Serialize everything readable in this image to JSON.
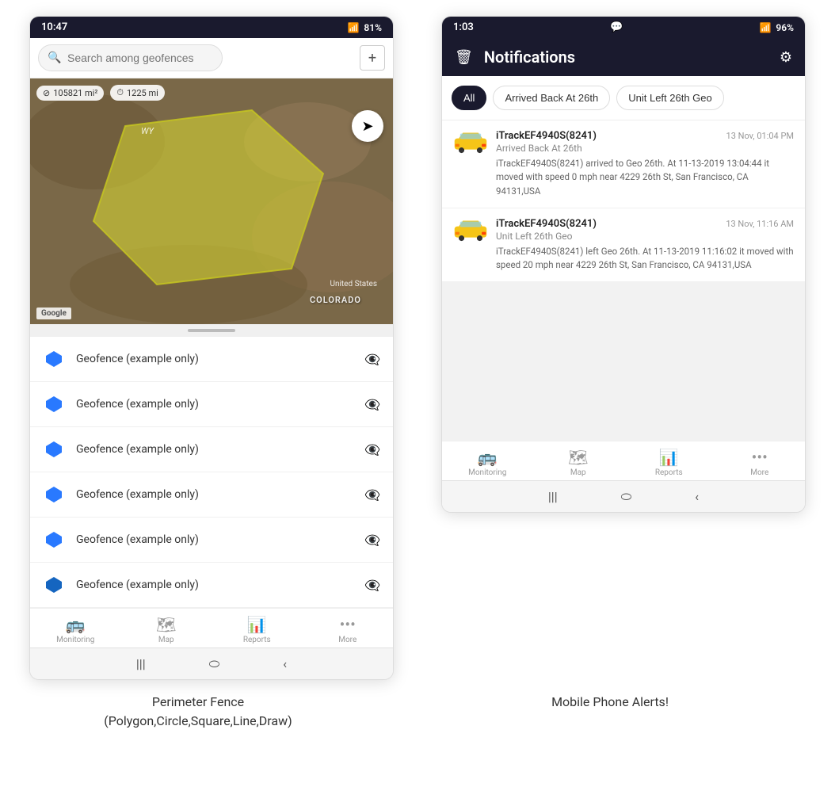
{
  "left_phone": {
    "status_bar": {
      "time": "10:47",
      "battery": "81%",
      "signal": "WiFi+LTE"
    },
    "search": {
      "placeholder": "Search among geofences"
    },
    "map": {
      "stat1_icon": "⊘",
      "stat1_value": "105821 mi²",
      "stat2_icon": "⏱",
      "stat2_value": "1225 mi",
      "wy_label": "WY",
      "colorado_label": "COLORADO",
      "us_label": "United States",
      "google_label": "Google"
    },
    "geofence_items": [
      {
        "name": "Geofence (example only)"
      },
      {
        "name": "Geofence (example only)"
      },
      {
        "name": "Geofence (example only)"
      },
      {
        "name": "Geofence (example only)"
      },
      {
        "name": "Geofence (example only)"
      },
      {
        "name": "Geofence (example only)"
      }
    ],
    "bottom_nav": [
      {
        "label": "Monitoring",
        "icon": "🚌"
      },
      {
        "label": "Map",
        "icon": "🗺"
      },
      {
        "label": "Reports",
        "icon": "📊"
      },
      {
        "label": "More",
        "icon": "···"
      }
    ]
  },
  "right_phone": {
    "status_bar": {
      "time": "1:03",
      "battery": "96%",
      "chat_icon": true
    },
    "header": {
      "title": "Notifications",
      "trash_label": "🗑",
      "settings_label": "⚙"
    },
    "filter_tabs": [
      {
        "label": "All",
        "active": true
      },
      {
        "label": "Arrived Back At 26th",
        "active": false
      },
      {
        "label": "Unit Left 26th Geo",
        "active": false
      }
    ],
    "notifications": [
      {
        "device": "iTrackEF4940S(8241)",
        "timestamp": "13 Nov, 01:04 PM",
        "event": "Arrived Back At 26th",
        "body": "iTrackEF4940S(8241) arrived to Geo 26th.    At 11-13-2019 13:04:44 it moved with speed 0 mph near 4229 26th St, San Francisco, CA 94131,USA"
      },
      {
        "device": "iTrackEF4940S(8241)",
        "timestamp": "13 Nov, 11:16 AM",
        "event": "Unit Left 26th Geo",
        "body": "iTrackEF4940S(8241) left Geo 26th.    At 11-13-2019 11:16:02 it moved with speed 20 mph near 4229 26th St, San Francisco, CA 94131,USA"
      }
    ],
    "bottom_nav": [
      {
        "label": "Monitoring",
        "icon": "🚌"
      },
      {
        "label": "Map",
        "icon": "🗺"
      },
      {
        "label": "Reports",
        "icon": "📊"
      },
      {
        "label": "More",
        "icon": "···"
      }
    ]
  },
  "captions": {
    "left": "Perimeter Fence\n(Polygon,Circle,Square,Line,Draw)",
    "right": "Mobile Phone Alerts!"
  }
}
